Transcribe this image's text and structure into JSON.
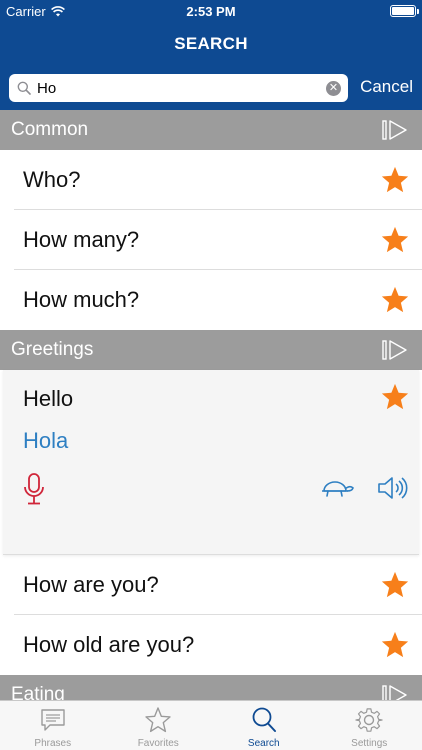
{
  "status_bar": {
    "carrier": "Carrier",
    "time": "2:53 PM"
  },
  "nav": {
    "title": "SEARCH"
  },
  "search": {
    "value": "Ho",
    "cancel_label": "Cancel"
  },
  "sections": {
    "common": {
      "title": "Common",
      "items": [
        "Who?",
        "How many?",
        "How much?"
      ]
    },
    "greetings": {
      "title": "Greetings",
      "expanded": {
        "phrase": "Hello",
        "translation": "Hola"
      },
      "items": [
        "How are you?",
        "How old are you?"
      ]
    },
    "eating": {
      "title": "Eating"
    }
  },
  "tabs": [
    {
      "label": "Phrases",
      "icon": "chat-bubble-icon"
    },
    {
      "label": "Favorites",
      "icon": "star-outline-icon"
    },
    {
      "label": "Search",
      "icon": "magnifier-icon"
    },
    {
      "label": "Settings",
      "icon": "gear-icon"
    }
  ],
  "colors": {
    "header": "#0e4a92",
    "section": "#9c9c9c",
    "star": "#f77f1a",
    "translation": "#2e7fc2",
    "mic": "#d0263a"
  }
}
